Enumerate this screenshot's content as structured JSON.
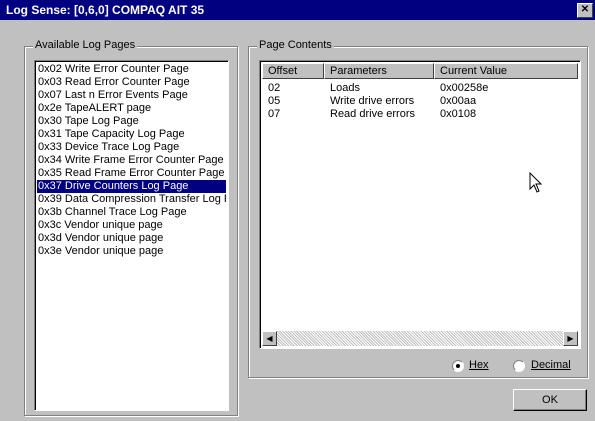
{
  "window": {
    "title": "Log Sense:  [0,6,0] COMPAQ AIT 35",
    "close_glyph": "✕"
  },
  "available_group": {
    "legend": "Available Log Pages"
  },
  "log_pages": [
    {
      "label": "0x02 Write Error Counter Page",
      "selected": false
    },
    {
      "label": "0x03 Read Error Counter Page",
      "selected": false
    },
    {
      "label": "0x07 Last n Error Events Page",
      "selected": false
    },
    {
      "label": "0x2e TapeALERT page",
      "selected": false
    },
    {
      "label": "0x30 Tape Log Page",
      "selected": false
    },
    {
      "label": "0x31 Tape Capacity Log Page",
      "selected": false
    },
    {
      "label": "0x33 Device Trace Log Page",
      "selected": false
    },
    {
      "label": "0x34 Write Frame Error Counter Page",
      "selected": false
    },
    {
      "label": "0x35 Read Frame Error Counter Page",
      "selected": false
    },
    {
      "label": "0x37 Drive Counters Log Page",
      "selected": true
    },
    {
      "label": "0x39 Data Compression Transfer Log P",
      "selected": false
    },
    {
      "label": "0x3b Channel Trace Log Page",
      "selected": false
    },
    {
      "label": "0x3c Vendor unique page",
      "selected": false
    },
    {
      "label": "0x3d Vendor unique page",
      "selected": false
    },
    {
      "label": "0x3e Vendor unique page",
      "selected": false
    }
  ],
  "contents_group": {
    "legend": "Page Contents"
  },
  "table": {
    "columns": [
      "Offset",
      "Parameters",
      "Current Value"
    ],
    "rows": [
      [
        "02",
        "Loads",
        "0x00258e"
      ],
      [
        "05",
        "Write drive errors",
        "0x00aa"
      ],
      [
        "07",
        "Read drive errors",
        "0x0108"
      ]
    ]
  },
  "scrollbar": {
    "left_glyph": "◀",
    "right_glyph": "▶"
  },
  "format": {
    "hex_label": "Hex",
    "decimal_label": "Decimal",
    "selected": "hex"
  },
  "ok_label": "OK"
}
